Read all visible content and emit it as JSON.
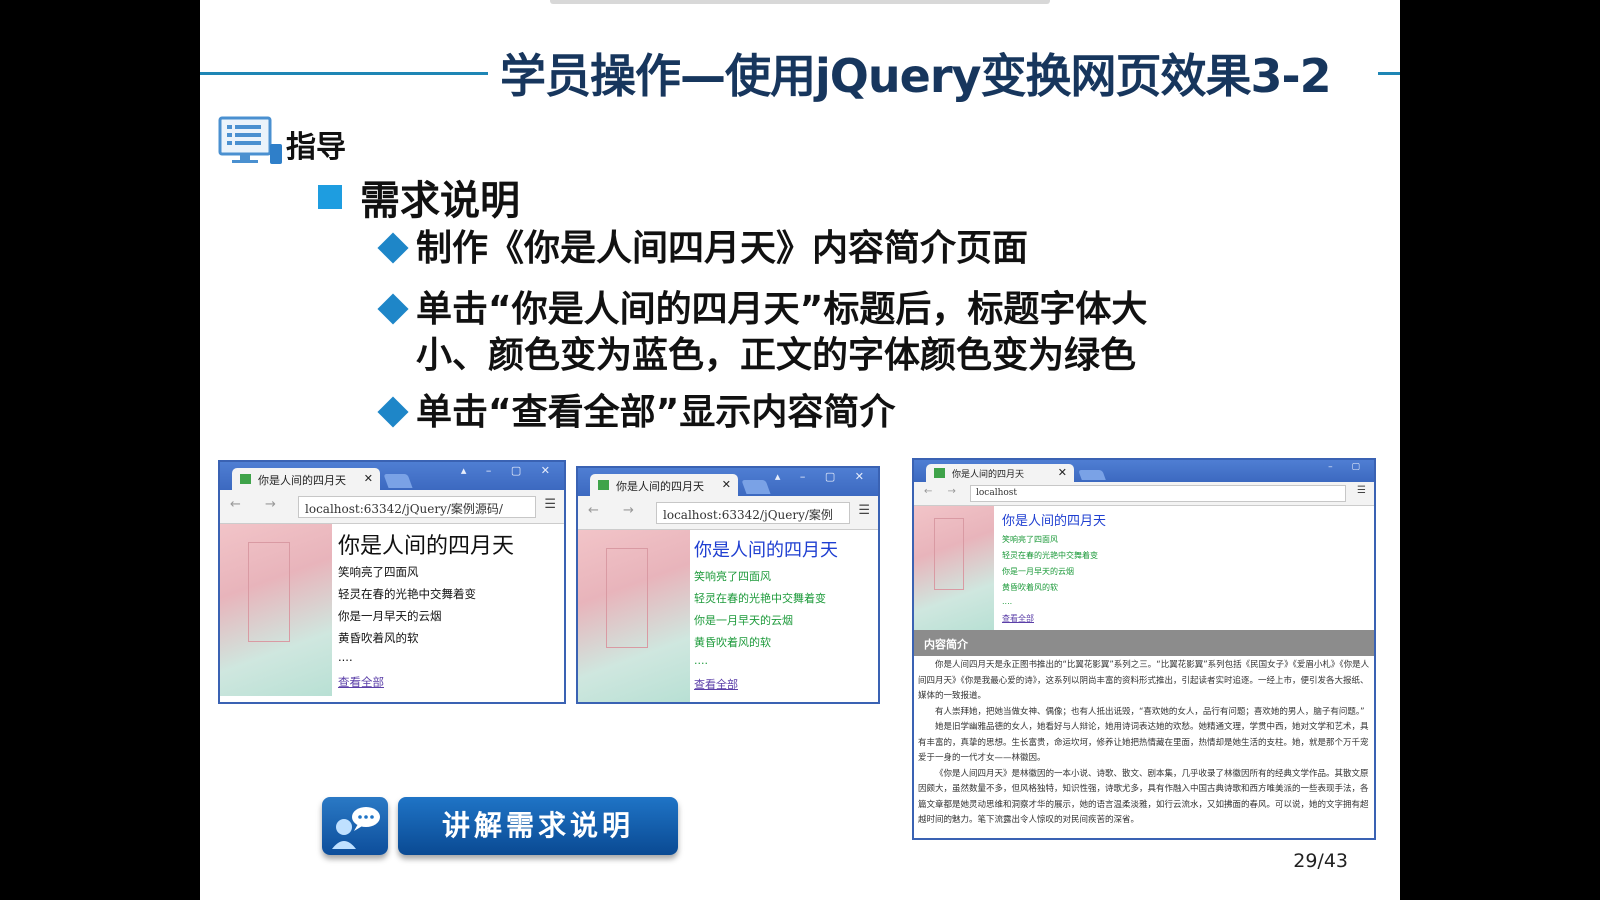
{
  "slide": {
    "title": "学员操作—使用jQuery变换网页效果3-2",
    "guide_label": "指导",
    "section_heading": "需求说明",
    "bullets": [
      [
        "制作《你是人间四月天》内容简介页面"
      ],
      [
        "单击“你是人间的四月天”标题后，标题字体大",
        "小、颜色变为蓝色，正文的字体颜色变为绿色"
      ],
      [
        "单击“查看全部”显示内容简介"
      ]
    ],
    "button_label": "讲解需求说明",
    "page_number": "29/43"
  },
  "browsers": [
    {
      "tab_title": "你是人间的四月天",
      "url": "localhost:63342/jQuery/案例源码/",
      "poem_title": "你是人间的四月天",
      "lines": [
        "笑响亮了四面风",
        "轻灵在春的光艳中交舞着变",
        "你是一月早天的云烟",
        "黄昏吹着风的软",
        "...."
      ],
      "more": "查看全部",
      "title_color": "#111111",
      "text_color": "#111111"
    },
    {
      "tab_title": "你是人间的四月天",
      "url": "localhost:63342/jQuery/案例",
      "poem_title": "你是人间的四月天",
      "lines": [
        "笑响亮了四面风",
        "轻灵在春的光艳中交舞着变",
        "你是一月早天的云烟",
        "黄昏吹着风的软",
        "...."
      ],
      "more": "查看全部",
      "title_color": "#1f3fd1",
      "text_color": "#1c9a3a"
    },
    {
      "tab_title": "你是人间的四月天",
      "url": "localhost",
      "poem_title": "你是人间的四月天",
      "lines": [
        "笑响亮了四面风",
        "轻灵在春的光艳中交舞着变",
        "你是一月早天的云烟",
        "黄昏吹着风的软",
        "...."
      ],
      "more": "查看全部",
      "title_color": "#1f3fd1",
      "text_color": "#1c9a3a",
      "intro_heading": "内容简介",
      "intro_paragraphs": [
        "你是人间四月天是永正图书推出的“比翼花影翼”系列之三。“比翼花影翼”系列包括《民国女子》《爱眉小札》《你是人间四月天》《你是我最心爱的诗》，这系列以阴尚丰富的资料形式推出，引起读者实时追逐。一经上市，便引发各大报纸、媒体的一致报道。",
        "有人崇拜她，把她当做女神、偶像；也有人抵出诋毁，“喜欢她的女人，品行有问题；喜欢她的男人，脑子有问题。”",
        "她是旧学幽雅品德的女人，她看好与人辩论，她用诗词表达她的欢愁。她精通文理，学贯中西，她对文学和艺术，具有丰富的，真挚的思想。生长富贵，命运坎坷，修养让她把热情藏在里面，热情却是她生活的支柱。她，就是那个万千宠爱于一身的一代才女——林徽因。",
        "《你是人间四月天》是林徽因的一本小说、诗歌、散文、剧本集，几乎收录了林徽因所有的经典文学作品。其散文原因颇大，虽然数量不多，但风格独特，知识性强，诗歌尤多，具有作融入中国古典诗歌和西方唯美派的一些表现手法，各篇文章都是她灵动思维和洞察才华的展示，她的语言温柔淡雅，如行云流水，又如拂面的春风。可以说，她的文字拥有超越时间的魅力。笔下流露出令人惊叹的对民间疾苦的深省。"
      ]
    }
  ]
}
